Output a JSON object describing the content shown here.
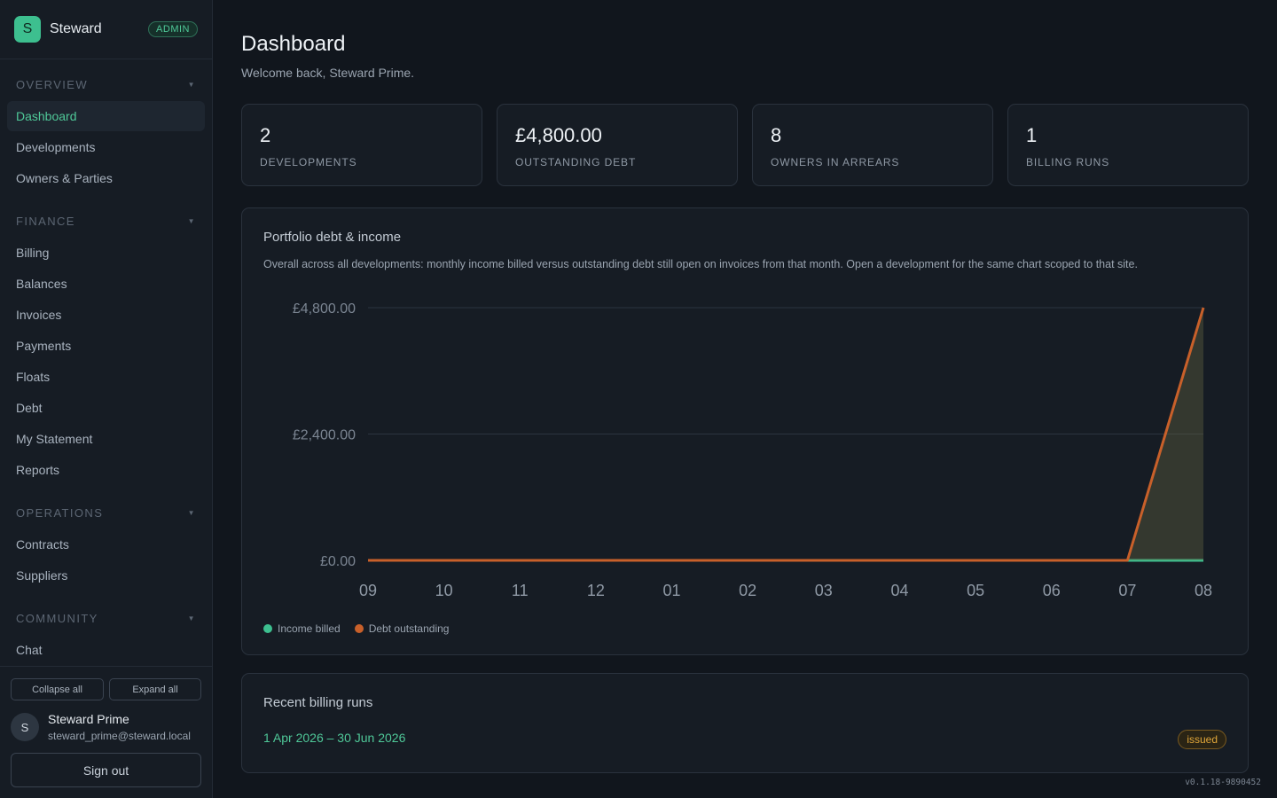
{
  "brand": {
    "logo_letter": "S",
    "name": "Steward",
    "badge": "ADMIN"
  },
  "sidebar": {
    "sections": [
      {
        "title": "OVERVIEW",
        "items": [
          "Dashboard",
          "Developments",
          "Owners & Parties"
        ]
      },
      {
        "title": "FINANCE",
        "items": [
          "Billing",
          "Balances",
          "Invoices",
          "Payments",
          "Floats",
          "Debt",
          "My Statement",
          "Reports"
        ]
      },
      {
        "title": "OPERATIONS",
        "items": [
          "Contracts",
          "Suppliers"
        ]
      },
      {
        "title": "COMMUNITY",
        "items": [
          "Chat"
        ]
      }
    ],
    "active_item": "Dashboard",
    "collapse_all": "Collapse all",
    "expand_all": "Expand all",
    "user": {
      "initial": "S",
      "name": "Steward Prime",
      "email": "steward_prime@steward.local"
    },
    "sign_out": "Sign out"
  },
  "header": {
    "title": "Dashboard",
    "subtitle": "Welcome back, Steward Prime."
  },
  "stats": [
    {
      "value": "2",
      "label": "DEVELOPMENTS"
    },
    {
      "value": "£4,800.00",
      "label": "OUTSTANDING DEBT"
    },
    {
      "value": "8",
      "label": "OWNERS IN ARREARS"
    },
    {
      "value": "1",
      "label": "BILLING RUNS"
    }
  ],
  "chart_panel": {
    "title": "Portfolio debt & income",
    "description": "Overall across all developments: monthly income billed versus outstanding debt still open on invoices from that month. Open a development for the same chart scoped to that site."
  },
  "chart_data": {
    "type": "area",
    "categories": [
      "09",
      "10",
      "11",
      "12",
      "01",
      "02",
      "03",
      "04",
      "05",
      "06",
      "07",
      "08"
    ],
    "y_ticks": [
      "£0.00",
      "£2,400.00",
      "£4,800.00"
    ],
    "ylim": [
      0,
      4800
    ],
    "grid": true,
    "legend_placement": "bottom-left",
    "series": [
      {
        "name": "Income billed",
        "color": "#3dbf8f",
        "values": [
          0,
          0,
          0,
          0,
          0,
          0,
          0,
          0,
          0,
          0,
          0,
          0
        ]
      },
      {
        "name": "Debt outstanding",
        "color": "#c8602a",
        "values": [
          0,
          0,
          0,
          0,
          0,
          0,
          0,
          0,
          0,
          0,
          0,
          4800
        ]
      }
    ]
  },
  "billing_runs": {
    "title": "Recent billing runs",
    "runs": [
      {
        "period": "1 Apr 2026 – 30 Jun 2026",
        "status": "issued"
      }
    ]
  },
  "version": "v0.1.18-9890452"
}
